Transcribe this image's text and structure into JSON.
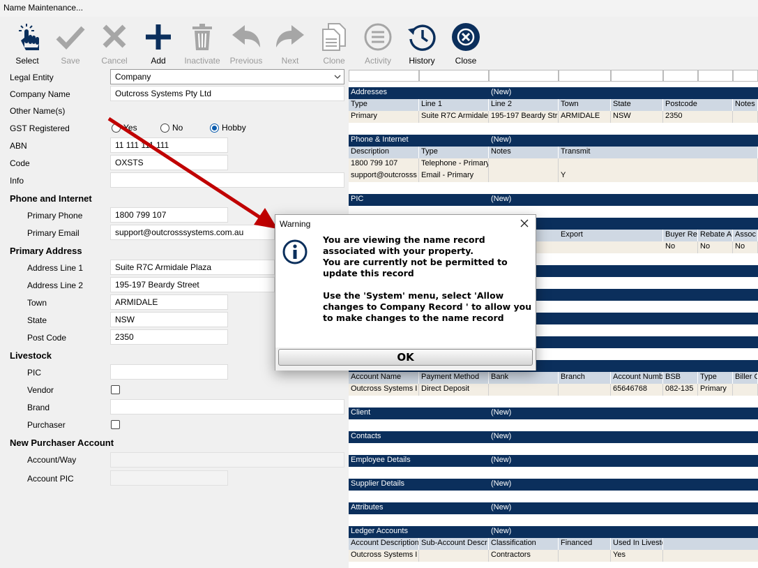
{
  "window": {
    "title": "Name Maintenance..."
  },
  "toolbar": {
    "select": "Select",
    "save": "Save",
    "cancel": "Cancel",
    "add": "Add",
    "inactivate": "Inactivate",
    "previous": "Previous",
    "next": "Next",
    "clone": "Clone",
    "activity": "Activity",
    "history": "History",
    "close": "Close"
  },
  "form": {
    "legal_entity_label": "Legal Entity",
    "legal_entity_value": "Company",
    "company_name_label": "Company Name",
    "company_name_value": "Outcross Systems Pty Ltd",
    "other_names_label": "Other Name(s)",
    "gst_label": "GST Registered",
    "gst_yes": "Yes",
    "gst_no": "No",
    "gst_hobby": "Hobby",
    "abn_label": "ABN",
    "abn_value": "11 111 111 111",
    "code_label": "Code",
    "code_value": "OXSTS",
    "info_label": "Info",
    "info_value": "",
    "phone_section": "Phone and Internet",
    "primary_phone_label": "Primary Phone",
    "primary_phone_value": "1800 799 107",
    "primary_email_label": "Primary Email",
    "primary_email_value": "support@outcrosssystems.com.au",
    "address_section": "Primary Address",
    "addr1_label": "Address Line 1",
    "addr1_value": "Suite R7C Armidale Plaza",
    "addr2_label": "Address Line 2",
    "addr2_value": "195-197 Beardy Street",
    "town_label": "Town",
    "town_value": "ARMIDALE",
    "state_label": "State",
    "state_value": "NSW",
    "postcode_label": "Post Code",
    "postcode_value": "2350",
    "livestock_section": "Livestock",
    "pic_label": "PIC",
    "vendor_label": "Vendor",
    "brand_label": "Brand",
    "purchaser_label": "Purchaser",
    "npa_section": "New Purchaser Account",
    "account_way_label": "Account/Way",
    "account_pic_label": "Account PIC"
  },
  "grid": {
    "new": "(New)",
    "addresses": {
      "title": "Addresses",
      "cols": [
        "Type",
        "Line 1",
        "Line 2",
        "Town",
        "State",
        "Postcode",
        "Notes"
      ],
      "row": [
        "Primary",
        "Suite R7C Armidale",
        "195-197 Beardy Str",
        "ARMIDALE",
        "NSW",
        "2350",
        ""
      ]
    },
    "phone": {
      "title": "Phone & Internet",
      "cols": [
        "Description",
        "Type",
        "Notes",
        "Transmit"
      ],
      "rows": [
        [
          "1800 799 107",
          "Telephone - Primary",
          "",
          ""
        ],
        [
          "support@outcrosss",
          "Email - Primary",
          "",
          "Y"
        ]
      ]
    },
    "pic": {
      "title": "PIC",
      "cols": [
        "Export",
        "Buyer Re",
        "Rebate A",
        "Assoc"
      ],
      "row": [
        "No",
        "No",
        "No"
      ]
    },
    "bank": {
      "cols": [
        "Account Name",
        "Payment Method",
        "Bank",
        "Branch",
        "Account Numb",
        "BSB",
        "Type",
        "Biller C"
      ],
      "row": [
        "Outcross Systems I",
        "Direct Deposit",
        "",
        "",
        "65646768",
        "082-135",
        "Primary",
        ""
      ]
    },
    "client": "Client",
    "contacts": "Contacts",
    "employee": "Employee Details",
    "supplier": "Supplier Details",
    "attributes": "Attributes",
    "ledger": {
      "title": "Ledger Accounts",
      "cols": [
        "Account Description",
        "Sub-Account Descr",
        "Classification",
        "Financed",
        "Used In Livesto"
      ],
      "row": [
        "Outcross Systems I",
        "",
        "Contractors",
        "",
        "Yes"
      ]
    }
  },
  "dialog": {
    "title": "Warning",
    "message": "You are viewing the name record associated with your property.\nYou are currently not be permitted to update this record\n\nUse the 'System' menu, select 'Allow changes to Company Record ' to allow you to make changes to the name record",
    "ok": "OK"
  },
  "colors": {
    "header": "#0b2f5c",
    "accent": "#0b5cad",
    "arrow": "#c00000"
  }
}
